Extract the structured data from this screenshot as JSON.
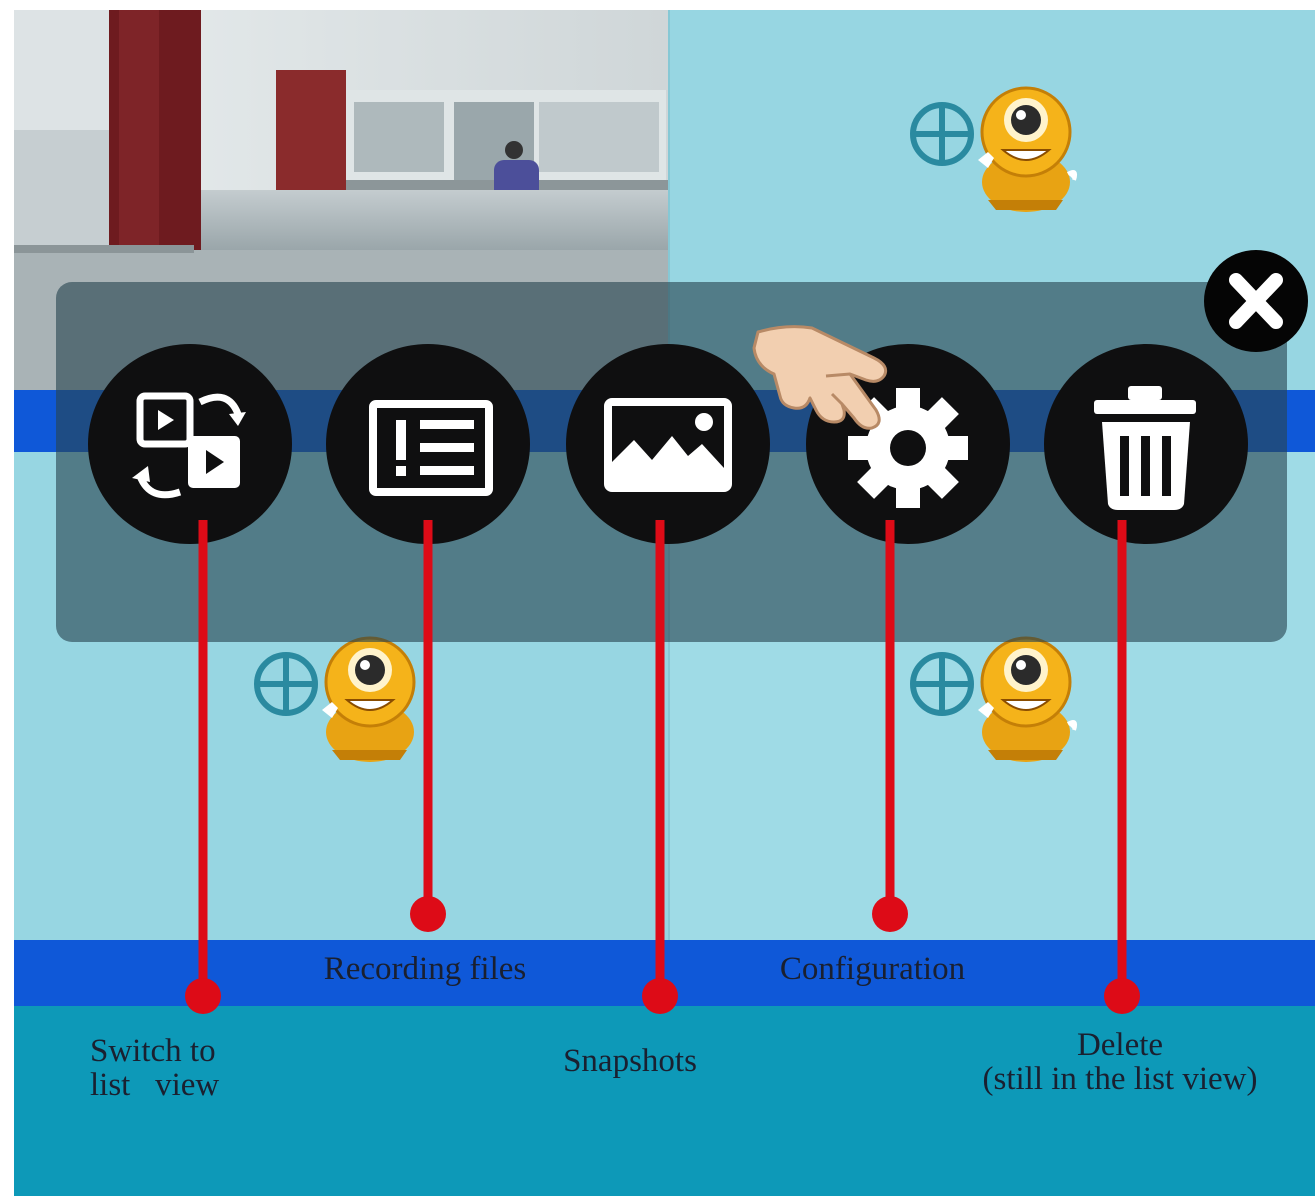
{
  "colors": {
    "light_tile": "#97d6e2",
    "tile_grid": "#86c8d5",
    "blue_bar": "#0f58d8",
    "teal_area": "#0d99b8",
    "overlay": "rgba(40,70,80,0.62)",
    "callout_red": "#dd0b17",
    "button_fill": "#0f0f10",
    "icon_white": "#ffffff"
  },
  "camera_feed": {
    "kind": "office-camera-view"
  },
  "add_camera_icons": [
    "plus-circle-icon",
    "mascot-webcam-icon"
  ],
  "toolbar": {
    "buttons": [
      {
        "id": "switch",
        "icon": "switch-view-icon"
      },
      {
        "id": "recordings",
        "icon": "list-icon"
      },
      {
        "id": "snapshots",
        "icon": "image-icon"
      },
      {
        "id": "config",
        "icon": "gear-icon"
      },
      {
        "id": "delete",
        "icon": "trash-icon"
      }
    ],
    "close_icon": "close-icon",
    "pointer_icon": "hand-pointer-icon"
  },
  "callouts": {
    "switch_view": "Switch to\nlist   view",
    "recording_files": "Recording files",
    "snapshots": "Snapshots",
    "configuration": "Configuration",
    "delete": "Delete\n(still in the list view)"
  }
}
